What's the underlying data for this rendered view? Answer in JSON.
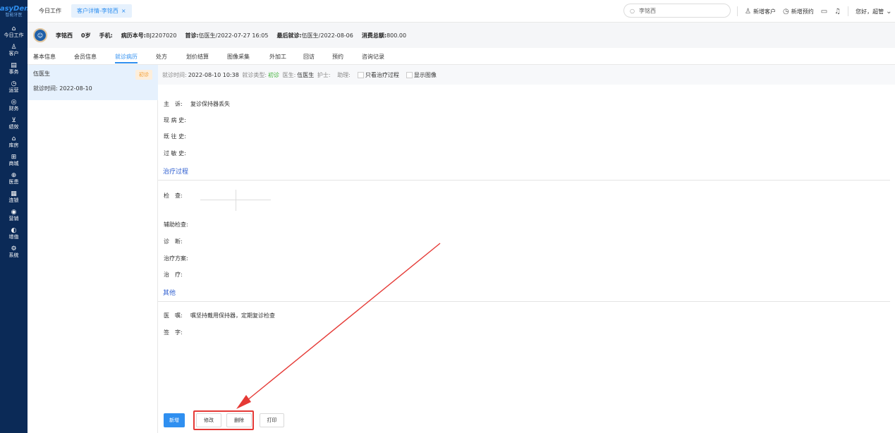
{
  "brand": {
    "name": "EasyDent",
    "subtitle": "智能牙医"
  },
  "nav": [
    {
      "icon": "⌂",
      "label": "今日工作"
    },
    {
      "icon": "♙",
      "label": "客户"
    },
    {
      "icon": "▤",
      "label": "事务"
    },
    {
      "icon": "◷",
      "label": "运营"
    },
    {
      "icon": "◎",
      "label": "财务"
    },
    {
      "icon": "⊻",
      "label": "绩效"
    },
    {
      "icon": "⌂",
      "label": "库房"
    },
    {
      "icon": "⊞",
      "label": "商城"
    },
    {
      "icon": "⊕",
      "label": "医患"
    },
    {
      "icon": "▦",
      "label": "连锁"
    },
    {
      "icon": "◉",
      "label": "营销"
    },
    {
      "icon": "◐",
      "label": "增值"
    },
    {
      "icon": "⚙",
      "label": "系统"
    }
  ],
  "topbar": {
    "home_tab": "今日工作",
    "active_tab": "客户详情-李铭西",
    "close": "×",
    "search_value": "李铭西",
    "actions": {
      "new_customer": "新增客户",
      "new_appointment": "新增预约",
      "greeting": "您好，超管"
    }
  },
  "patient": {
    "name": "李铭西",
    "age": "0岁",
    "phone_label": "手机:",
    "record_label": "病历本号:",
    "record_no": "BJ2207020",
    "first_label": "首诊:",
    "first_value": "伍医生/2022-07-27 16:05",
    "last_label": "最后就诊:",
    "last_value": "伍医生/2022-08-06",
    "spend_label": "消费总额:",
    "spend_value": "800.00"
  },
  "subtabs": [
    "基本信息",
    "会员信息",
    "就诊病历",
    "处方",
    "划价结算",
    "图像采集",
    "外加工",
    "回访",
    "预约",
    "咨询记录"
  ],
  "visit": {
    "doctor": "伍医生",
    "badge": "初诊",
    "date_label": "就诊时间:",
    "date": "2022-08-10"
  },
  "infobar": {
    "time_label": "就诊时间:",
    "time": "2022-08-10 10:38",
    "type_label": "就诊类型:",
    "type": "初诊",
    "doctor_label": "医生:",
    "doctor": "伍医生",
    "nurse_label": "护士:",
    "assistant_label": "助理:",
    "only_treatment": "只看治疗过程",
    "show_images": "显示图像"
  },
  "record": {
    "chief_label": "主　诉:",
    "chief": "复诊保持器丢失",
    "present_label": "现 病 史:",
    "past_label": "既 往 史:",
    "allergy_label": "过 敏 史:",
    "section_treatment": "治疗过程",
    "exam_label": "检　查:",
    "aux_label": "辅助检查:",
    "diag_label": "诊　断:",
    "plan_label": "治疗方案:",
    "treat_label": "治　疗:",
    "section_other": "其他",
    "advice_label": "医　嘱:",
    "advice": "嘱坚持戴用保持器，定期复诊检查",
    "sign_label": "签　字:"
  },
  "buttons": {
    "new": "新增",
    "edit": "修改",
    "delete": "删除",
    "print": "打印"
  },
  "colors": {
    "nav_bg": "#0b2a57",
    "accent": "#2f8ff0",
    "highlight": "#e53935"
  }
}
